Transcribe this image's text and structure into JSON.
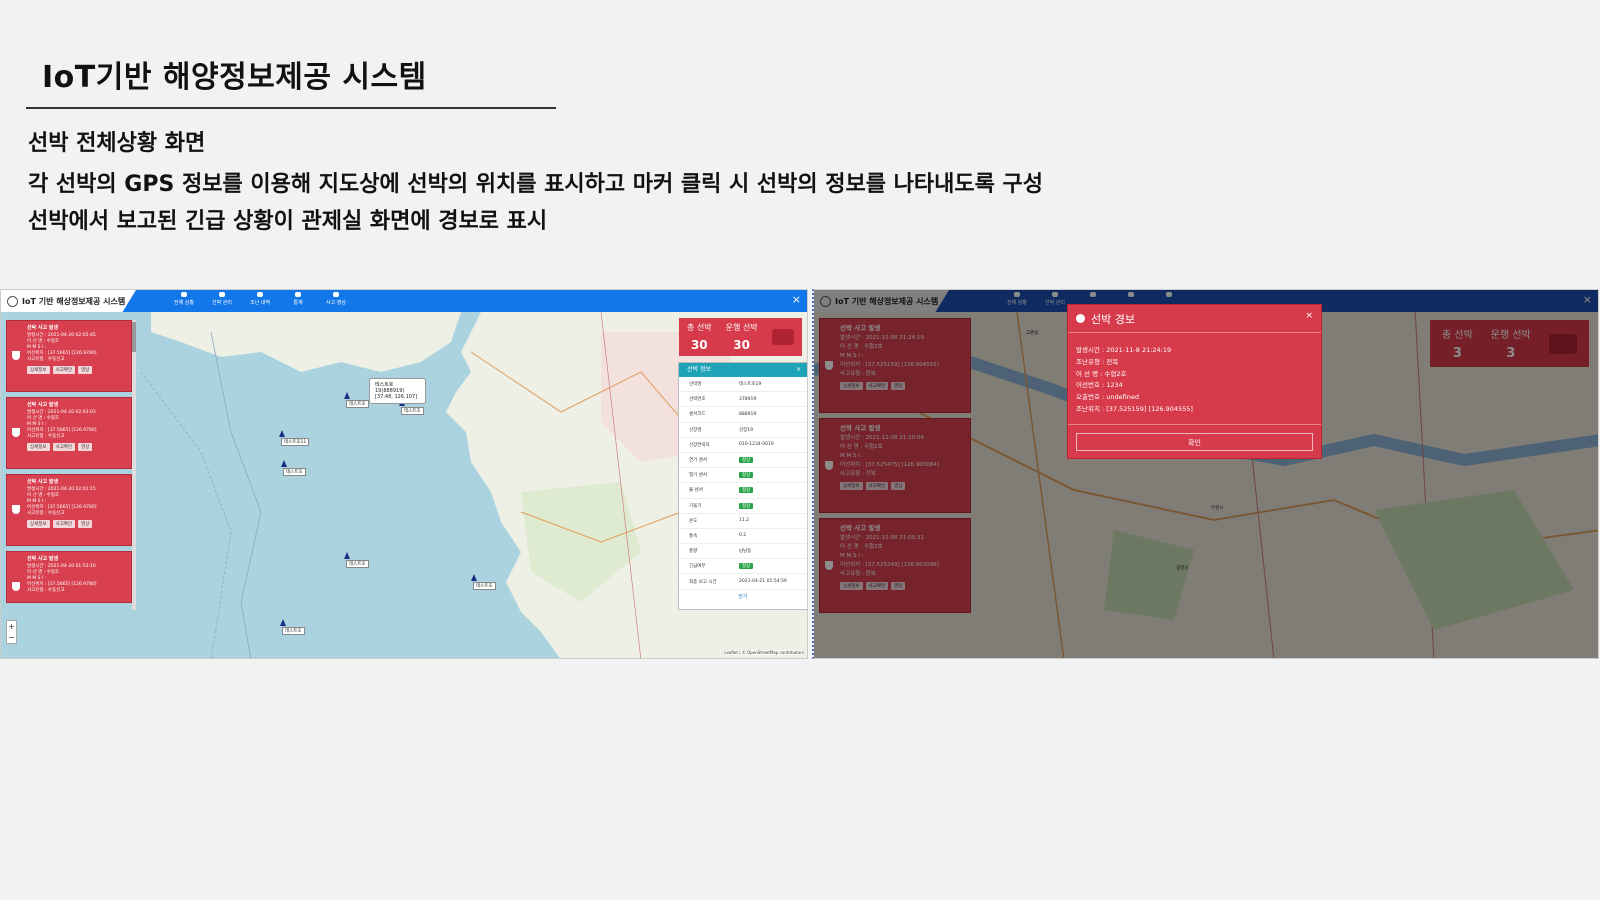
{
  "slide": {
    "title": "IoT기반 해양정보제공 시스템",
    "bullets": [
      "선박 전체상황 화면",
      "각 선박의 GPS 정보를 이용해 지도상에 선박의 위치를 표시하고 마커 클릭 시 선박의 정보를 나타내도록 구성",
      "선박에서 보고된 긴급 상황이 관제실 화면에 경보로 표시"
    ]
  },
  "app": {
    "title": "IoT 기반 해상정보제공 시스템",
    "close": "×",
    "nav": [
      "전체 상황",
      "선박 관리",
      "조난 내역",
      "통계",
      "사고 영상"
    ]
  },
  "left": {
    "cards": [
      {
        "title": "선박 사고 발생",
        "lines": [
          "발생시간 : 2021-04-20 02:05:45",
          "어 선 명 : 수협호",
          "M M S I :",
          "어선위치 : [37.5665] [126.9780]",
          "사고유형 : 수동신고"
        ]
      },
      {
        "title": "선박 사고 발생",
        "lines": [
          "발생시간 : 2021-04-20 02:03:03",
          "어 선 명 : 수협호",
          "M M S I :",
          "어선위치 : [37.5665] [126.9780]",
          "사고유형 : 수동신고"
        ]
      },
      {
        "title": "선박 사고 발생",
        "lines": [
          "발생시간 : 2021-04-20 02:01:15",
          "어 선 명 : 수협호",
          "M M S I :",
          "어선위치 : [37.5665] [126.9780]",
          "사고유형 : 수동신고"
        ]
      },
      {
        "title": "선박 사고 발생",
        "lines": [
          "발생시간 : 2021-04-20 01:53:10",
          "어 선 명 : 수협호",
          "M M S I :",
          "어선위치 : [37.5665] [126.9780]",
          "사고유형 : 수동신고"
        ]
      }
    ],
    "card_buttons": [
      "상세정보",
      "사고확인",
      "영상"
    ],
    "counter": {
      "total_label": "총 선박",
      "total": "30",
      "active_label": "운행 선박",
      "active": "30"
    },
    "shipinfo": {
      "header": "선박 정보",
      "close": "×",
      "rows": [
        {
          "k": "선박명",
          "v": "테스트호19"
        },
        {
          "k": "선박번호",
          "v": "378919"
        },
        {
          "k": "센서코드",
          "v": "888919"
        },
        {
          "k": "선장명",
          "v": "선장19"
        },
        {
          "k": "선장연락처",
          "v": "010-1234-0019"
        },
        {
          "k": "연기 센서",
          "v": "정상",
          "ok": true
        },
        {
          "k": "열기 센서",
          "v": "정상",
          "ok": true
        },
        {
          "k": "불 센서",
          "v": "정상",
          "ok": true
        },
        {
          "k": "기울기",
          "v": "정상",
          "ok": true
        },
        {
          "k": "온도",
          "v": "11.2"
        },
        {
          "k": "풍속",
          "v": "0.2"
        },
        {
          "k": "풍향",
          "v": "남남동"
        },
        {
          "k": "긴급여부",
          "v": "정상",
          "ok": true
        },
        {
          "k": "최종 보고 시간",
          "v": "2021-04-21 01:54:59"
        }
      ],
      "footer": "닫기"
    },
    "popup": [
      "테스트호19(888919)",
      "[37.48, 126.107]"
    ],
    "markers": [
      "테스트호",
      "테스트호11",
      "테스트호",
      "테스트호",
      "테스트호",
      "테스트호",
      "테스트호"
    ],
    "zoom_in": "+",
    "zoom_out": "−",
    "attribution": "Leaflet | © OpenStreetMap contributors"
  },
  "right": {
    "cards": [
      {
        "title": "선박 사고 발생",
        "lines": [
          "발생시간 : 2021-11-08 21:24:19",
          "어 선 명 : 수협2호",
          "M M S I :",
          "어선위치 : [37.525159] [126.904555]",
          "사고유형 : 전복"
        ]
      },
      {
        "title": "선박 사고 발생",
        "lines": [
          "발생시간 : 2021-11-08 21:10:04",
          "어 선 명 : 수협2호",
          "M M S I :",
          "어선위치 : [37.525475] [126.903684]",
          "사고유형 : 전복"
        ]
      },
      {
        "title": "선박 사고 발생",
        "lines": [
          "발생시간 : 2021-11-08 21:00:31",
          "어 선 명 : 수협2호",
          "M M S I :",
          "어선위치 : [37.525249] [126.903096]",
          "사고유형 : 전복"
        ]
      }
    ],
    "card_buttons": [
      "상세정보",
      "사고확인",
      "영상"
    ],
    "counter": {
      "total_label": "총 선박",
      "total": "3",
      "active_label": "운행 선박",
      "active": "3"
    },
    "alert": {
      "title": "선박 경보",
      "close": "×",
      "lines": [
        "발생시간 : 2021-11-8 21:24:19",
        "조난유형 : 전복",
        "어 선 명 : 수협2호",
        "어선번호 : 1234",
        "오출번호 : undefined",
        "조난위치 : [37.525159] [126.904555]"
      ],
      "confirm": "확인"
    },
    "map_labels": [
      "부천시",
      "광명시",
      "고촌읍"
    ]
  },
  "colors": {
    "accent_blue": "#1277e8",
    "alert_red": "#d73a4a",
    "ok_green": "#2aa64a",
    "info_teal": "#1ea3b8"
  }
}
